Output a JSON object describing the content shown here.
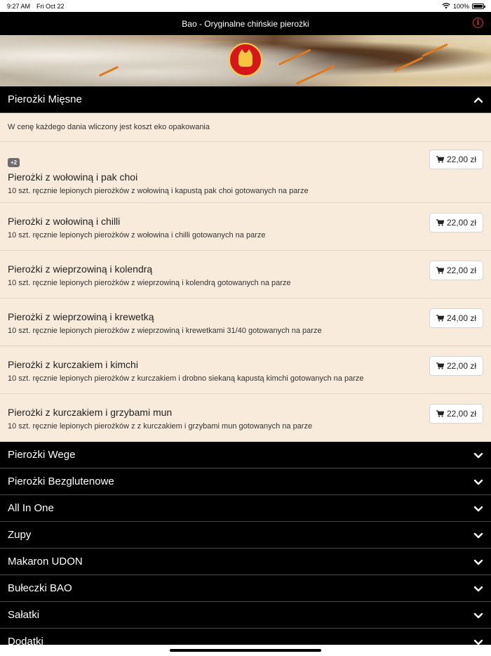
{
  "status": {
    "time": "9:27 AM",
    "date": "Fri Oct 22",
    "battery": "100%"
  },
  "app": {
    "title": "Bao - Oryginalne chińskie pierożki",
    "info_icon": "info-icon"
  },
  "menu": {
    "expanded_section": {
      "title": "Pierożki Mięsne",
      "note": "W cenę każdego dania wliczony jest koszt eko opakowania",
      "items": [
        {
          "badge": "+2",
          "name": "Pierożki z wołowiną i pak choi",
          "desc": "10 szt. ręcznie lepionych pierożków z wołowiną i kapustą pak choi gotowanych na parze",
          "price": "22,00 zł"
        },
        {
          "badge": "",
          "name": "Pierożki z wołowiną i chilli",
          "desc": "10 szt. ręcznie lepionych pierożków z wołowina i chilli gotowanych na parze",
          "price": "22,00 zł"
        },
        {
          "badge": "",
          "name": "Pierożki z wieprzowiną i kolendrą",
          "desc": "10 szt. ręcznie lepionych pierożków z wieprzowiną i kolendrą gotowanych na parze",
          "price": "22,00 zł"
        },
        {
          "badge": "",
          "name": "Pierożki z wieprzowiną i krewetką",
          "desc": "10 szt. ręcznie lepionych pierożków z wieprzowiną i krewetkami 31/40 gotowanych na parze",
          "price": "24,00 zł"
        },
        {
          "badge": "",
          "name": "Pierożki z kurczakiem i kimchi",
          "desc": "10 szt. ręcznie lepionych pierożków z kurczakiem i drobno siekaną kapustą kimchi gotowanych na parze",
          "price": "22,00 zł"
        },
        {
          "badge": "",
          "name": "Pierożki z kurczakiem i grzybami mun",
          "desc": "10 szt. ręcznie lepionych pierożków z z kurczakiem i grzybami mun gotowanych na parze",
          "price": "22,00 zł"
        }
      ]
    },
    "collapsed_sections": [
      "Pierożki Wege",
      "Pierożki Bezglutenowe",
      "All In One",
      "Zupy",
      "Makaron UDON",
      "Bułeczki BAO",
      "Sałatki",
      "Dodatki"
    ]
  },
  "colors": {
    "header_bg": "#000000",
    "body_bg": "#f8ebdc",
    "accent_red": "#e53935"
  }
}
